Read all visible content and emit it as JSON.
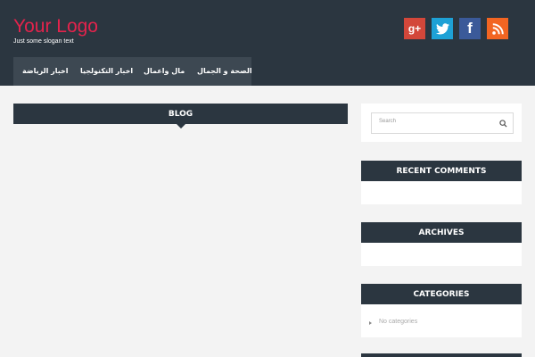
{
  "header": {
    "logo": "Your Logo",
    "slogan": "Just some slogan text"
  },
  "social": {
    "gplus": "g+",
    "facebook": "f"
  },
  "nav": {
    "items": [
      {
        "label": "الصحة و الجمال"
      },
      {
        "label": "مال واعمال"
      },
      {
        "label": "اخبار التكنولجيا"
      },
      {
        "label": "اخبار الرياضة"
      }
    ]
  },
  "main": {
    "section_title": "BLOG"
  },
  "sidebar": {
    "search_placeholder": "Search",
    "recent_comments_title": "RECENT COMMENTS",
    "archives_title": "ARCHIVES",
    "categories_title": "CATEGORIES",
    "categories_empty": "No categories"
  },
  "colors": {
    "header_bg": "#2b3640",
    "logo": "#e4234c",
    "page_bg": "#f3f3f3"
  }
}
